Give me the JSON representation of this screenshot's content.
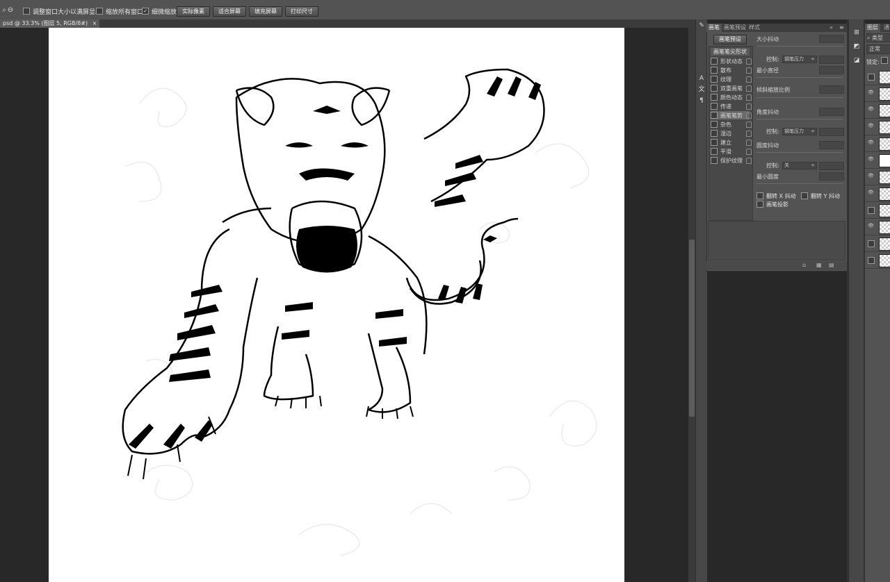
{
  "options_bar": {
    "resize_windows": "调整窗口大小以满屏显示",
    "zoom_all_windows": "缩放所有窗口",
    "scrubby_zoom": "细微缩放",
    "actual_pixels": "实际像素",
    "fit_screen": "适合屏幕",
    "fill_screen": "填充屏幕",
    "print_size": "打印尺寸"
  },
  "document": {
    "tab_label": "psd @ 33.3% (图层 5, RGB/8#)",
    "close": "×"
  },
  "brush_panel": {
    "tabs": [
      "画笔",
      "画笔预设",
      "样式"
    ],
    "preset_button": "画笔预设",
    "list_header": "画笔笔尖形状",
    "options": [
      {
        "label": "形状动态"
      },
      {
        "label": "散布"
      },
      {
        "label": "纹理"
      },
      {
        "label": "双重画笔"
      },
      {
        "label": "颜色动态"
      },
      {
        "label": "传递"
      },
      {
        "label": "画笔笔势"
      },
      {
        "label": "杂色"
      },
      {
        "label": "湿边"
      },
      {
        "label": "建立"
      },
      {
        "label": "平滑"
      },
      {
        "label": "保护纹理"
      }
    ],
    "size_jitter": "大小抖动",
    "control": "控制:",
    "pen_pressure": "钢笔压力",
    "min_diameter": "最小直径",
    "tilt_scale": "倾斜缩放比例",
    "angle_jitter": "角度抖动",
    "roundness_jitter": "圆度抖动",
    "off": "关",
    "min_roundness": "最小圆度",
    "flip_x": "翻转 X 抖动",
    "flip_y": "翻转 Y 抖动",
    "brush_projection": "画笔投影"
  },
  "layers_panel": {
    "tabs": [
      "图层",
      "通"
    ],
    "kind_filter": "类型",
    "blend_mode": "正常",
    "lock": "锁定:"
  }
}
